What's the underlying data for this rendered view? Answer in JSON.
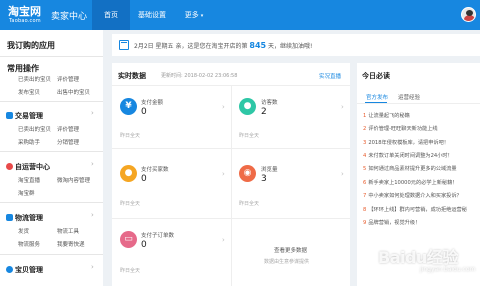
{
  "header": {
    "logo_main": "淘宝网",
    "logo_sub": "Taobao.com",
    "seller_center": "卖家中心",
    "tabs": [
      {
        "label": "首页"
      },
      {
        "label": "基础设置"
      },
      {
        "label": "更多"
      }
    ],
    "more_caret": "▾"
  },
  "sidebar": {
    "title": "我订购的应用",
    "common_ops": {
      "title": "常用操作",
      "links": [
        "已卖出的宝贝",
        "评价管理",
        "发布宝贝",
        "出售中的宝贝"
      ]
    },
    "sections": [
      {
        "title": "交易管理",
        "icon": "trade-icon",
        "links": [
          "已卖出的宝贝",
          "评价管理",
          "采购助手",
          "分销管理"
        ]
      },
      {
        "title": "自运营中心",
        "icon": "self-operation-icon",
        "links": [
          "淘宝直播",
          "微淘内容管理",
          "淘宝群"
        ]
      },
      {
        "title": "物流管理",
        "icon": "logistics-icon",
        "links": [
          "发货",
          "物流工具",
          "物流服务",
          "我要寄快递"
        ]
      },
      {
        "title": "宝贝管理",
        "icon": "product-icon",
        "links": []
      }
    ],
    "chevron": "›",
    "colors": {
      "trade": "#1787e0",
      "self": "#e84a4a",
      "logistics": "#1787e0",
      "product": "#1787e0"
    }
  },
  "notice": {
    "prefix": "2月2日 星期五 亲，这是您在淘宝开店的第",
    "days": "845",
    "suffix": "天，继续加油哦!"
  },
  "realtime": {
    "title": "实时数据",
    "update_time": "更新时间: 2018-02-02 23:06:58",
    "live_link": "实况直播",
    "metrics": [
      {
        "label": "支付金额",
        "value": "0",
        "sub": "昨日全天",
        "icon": "yen-icon",
        "glyph": "¥",
        "color": "#1787e0"
      },
      {
        "label": "访客数",
        "value": "2",
        "sub": "昨日全天",
        "icon": "visitors-icon",
        "glyph": "●",
        "color": "#2ec7a6"
      },
      {
        "label": "支付买家数",
        "value": "0",
        "sub": "昨日全天",
        "icon": "buyers-icon",
        "glyph": "●",
        "color": "#f5a623"
      },
      {
        "label": "浏览量",
        "value": "3",
        "sub": "昨日全天",
        "icon": "pageviews-icon",
        "glyph": "◉",
        "color": "#ef6b47"
      },
      {
        "label": "支付子订单数",
        "value": "0",
        "sub": "昨日全天",
        "icon": "orders-icon",
        "glyph": "▭",
        "color": "#e66a8a"
      }
    ],
    "more_link": "查看更多数据",
    "more_sub": "数据由生意参谋提供",
    "chevron": "›"
  },
  "required_reading": {
    "title": "今日必读",
    "tabs": [
      {
        "label": "官方发布"
      },
      {
        "label": "运营经验"
      }
    ],
    "items": [
      {
        "num": "1",
        "text": "让流量起飞的秘籍"
      },
      {
        "num": "2",
        "text": "评价管理-旺旺聊天新功能上线"
      },
      {
        "num": "3",
        "text": "2018年侵权模板库，请把申诉吧！"
      },
      {
        "num": "4",
        "text": "未付款订单关闭时间调整为24小时！"
      },
      {
        "num": "5",
        "text": "如何通过商品素材提升更多的公域流量"
      },
      {
        "num": "6",
        "text": "新手卖家上10000元的必学上新秘籍！"
      },
      {
        "num": "7",
        "text": "中小卖家如何处理数据介入和买家投诉？"
      },
      {
        "num": "8",
        "text": "【环环上线】群内可营销，成功拒绝运营秘"
      },
      {
        "num": "9",
        "text": "品牌营销，视觉升级！"
      }
    ]
  },
  "watermark": {
    "text": "Baidu经验",
    "sub": "jingyan.baidu.com"
  }
}
